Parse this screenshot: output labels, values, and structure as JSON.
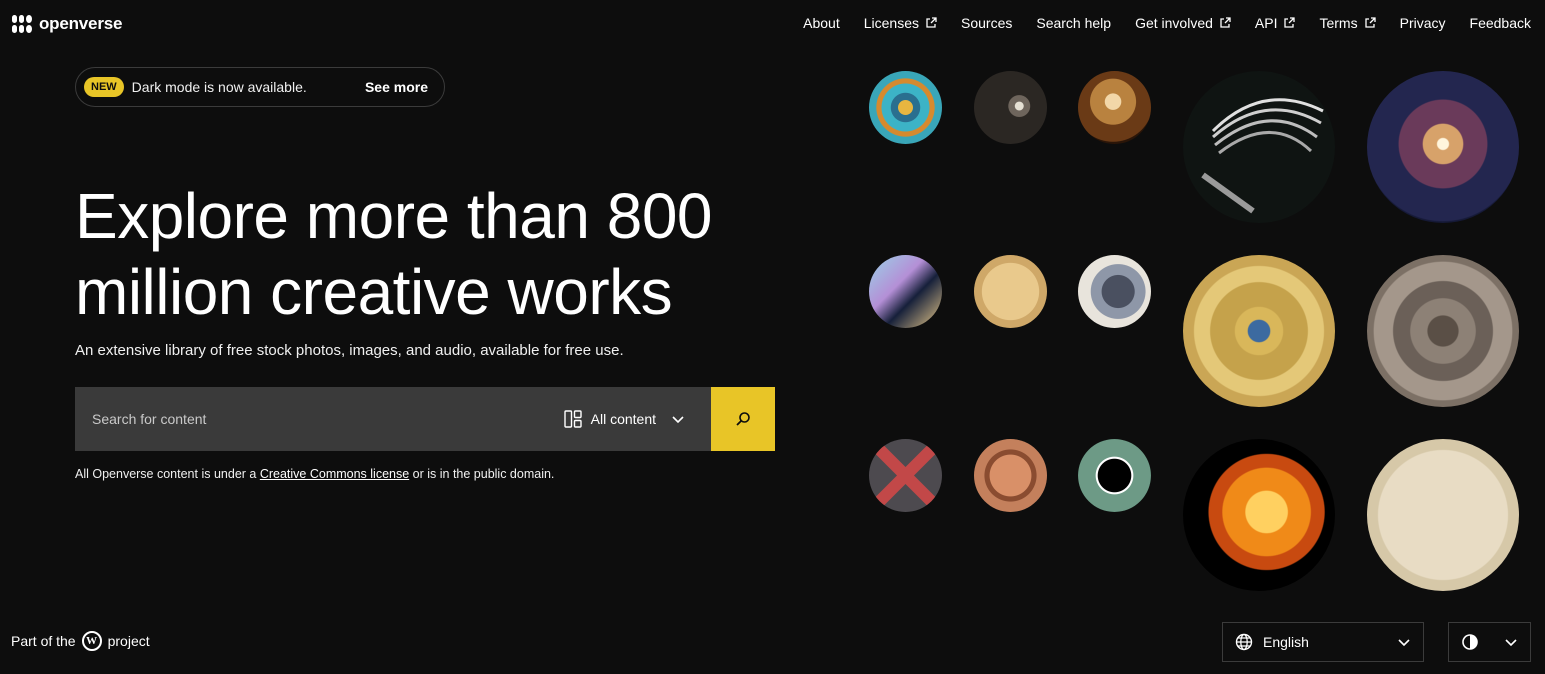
{
  "header": {
    "logo_text": "openverse",
    "nav": [
      {
        "label": "About",
        "external": false
      },
      {
        "label": "Licenses",
        "external": true
      },
      {
        "label": "Sources",
        "external": false
      },
      {
        "label": "Search help",
        "external": false
      },
      {
        "label": "Get involved",
        "external": true
      },
      {
        "label": "API",
        "external": true
      },
      {
        "label": "Terms",
        "external": true
      },
      {
        "label": "Privacy",
        "external": false
      },
      {
        "label": "Feedback",
        "external": false
      }
    ]
  },
  "banner": {
    "badge": "NEW",
    "text": "Dark mode is now available.",
    "link": "See more"
  },
  "hero": {
    "title_line1": "Explore more than 800",
    "title_line2": "million creative works",
    "subtitle": "An extensive library of free stock photos, images, and audio, available for free use."
  },
  "search": {
    "placeholder": "Search for content",
    "content_type": "All content",
    "license_prefix": "All Openverse content is under a ",
    "license_link": "Creative Commons license",
    "license_suffix": " or is in the public domain."
  },
  "footer": {
    "part_of_prefix": "Part of the",
    "part_of_suffix": "project",
    "language": "English"
  },
  "colors": {
    "background": "#0d0d0d",
    "accent": "#e8c527",
    "search_bg": "#3a3a3a"
  },
  "gallery": [
    {
      "name": "kaleidoscope-mandala-image"
    },
    {
      "name": "comet-engraving-image"
    },
    {
      "name": "nebula-cloud-image"
    },
    {
      "name": "comet-tail-engraving-image"
    },
    {
      "name": "star-cluster-image"
    },
    {
      "name": "planet-crescent-image"
    },
    {
      "name": "star-chart-parchment-image"
    },
    {
      "name": "bird-illustration-image"
    },
    {
      "name": "celestial-map-septem-image"
    },
    {
      "name": "aztec-calendar-stone-image"
    },
    {
      "name": "woven-pattern-image"
    },
    {
      "name": "carved-wood-disc-image"
    },
    {
      "name": "solar-eclipse-image"
    },
    {
      "name": "solar-flare-image"
    },
    {
      "name": "constellation-map-image"
    }
  ]
}
